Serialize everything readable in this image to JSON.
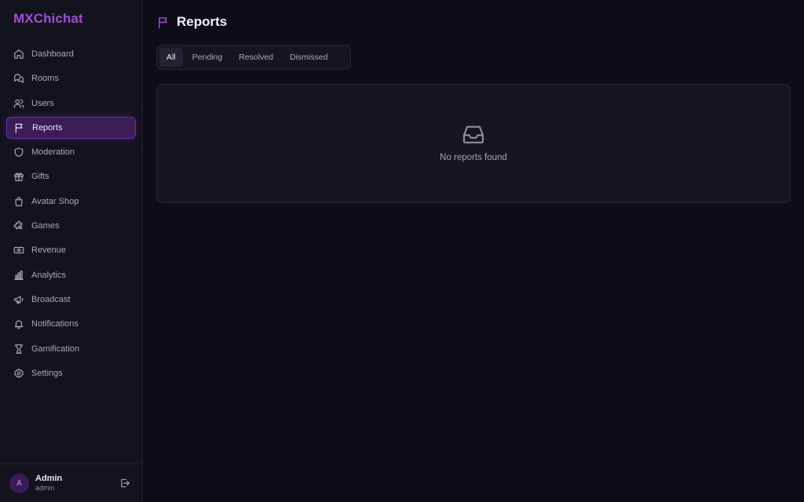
{
  "brand": {
    "name": "MXChichat",
    "color": "#a34bdb"
  },
  "sidebar": {
    "items": [
      {
        "label": "Dashboard",
        "icon": "home-icon",
        "active": false
      },
      {
        "label": "Rooms",
        "icon": "chat-bubbles-icon",
        "active": false
      },
      {
        "label": "Users",
        "icon": "users-icon",
        "active": false
      },
      {
        "label": "Reports",
        "icon": "flag-icon",
        "active": true
      },
      {
        "label": "Moderation",
        "icon": "shield-icon",
        "active": false
      },
      {
        "label": "Gifts",
        "icon": "gift-icon",
        "active": false
      },
      {
        "label": "Avatar Shop",
        "icon": "shopping-bag-icon",
        "active": false
      },
      {
        "label": "Games",
        "icon": "puzzle-icon",
        "active": false
      },
      {
        "label": "Revenue",
        "icon": "banknote-icon",
        "active": false
      },
      {
        "label": "Analytics",
        "icon": "bar-chart-icon",
        "active": false
      },
      {
        "label": "Broadcast",
        "icon": "megaphone-icon",
        "active": false
      },
      {
        "label": "Notifications",
        "icon": "bell-icon",
        "active": false
      },
      {
        "label": "Gamification",
        "icon": "trophy-icon",
        "active": false
      },
      {
        "label": "Settings",
        "icon": "gear-icon",
        "active": false
      }
    ]
  },
  "user": {
    "initial": "A",
    "name": "Admin",
    "role": "admin"
  },
  "page": {
    "title": "Reports",
    "icon": "flag-icon",
    "accent": "#a34bdb"
  },
  "tabs": [
    {
      "label": "All",
      "active": true
    },
    {
      "label": "Pending",
      "active": false
    },
    {
      "label": "Resolved",
      "active": false
    },
    {
      "label": "Dismissed",
      "active": false
    }
  ],
  "empty_state": {
    "icon": "inbox-icon",
    "message": "No reports found"
  }
}
